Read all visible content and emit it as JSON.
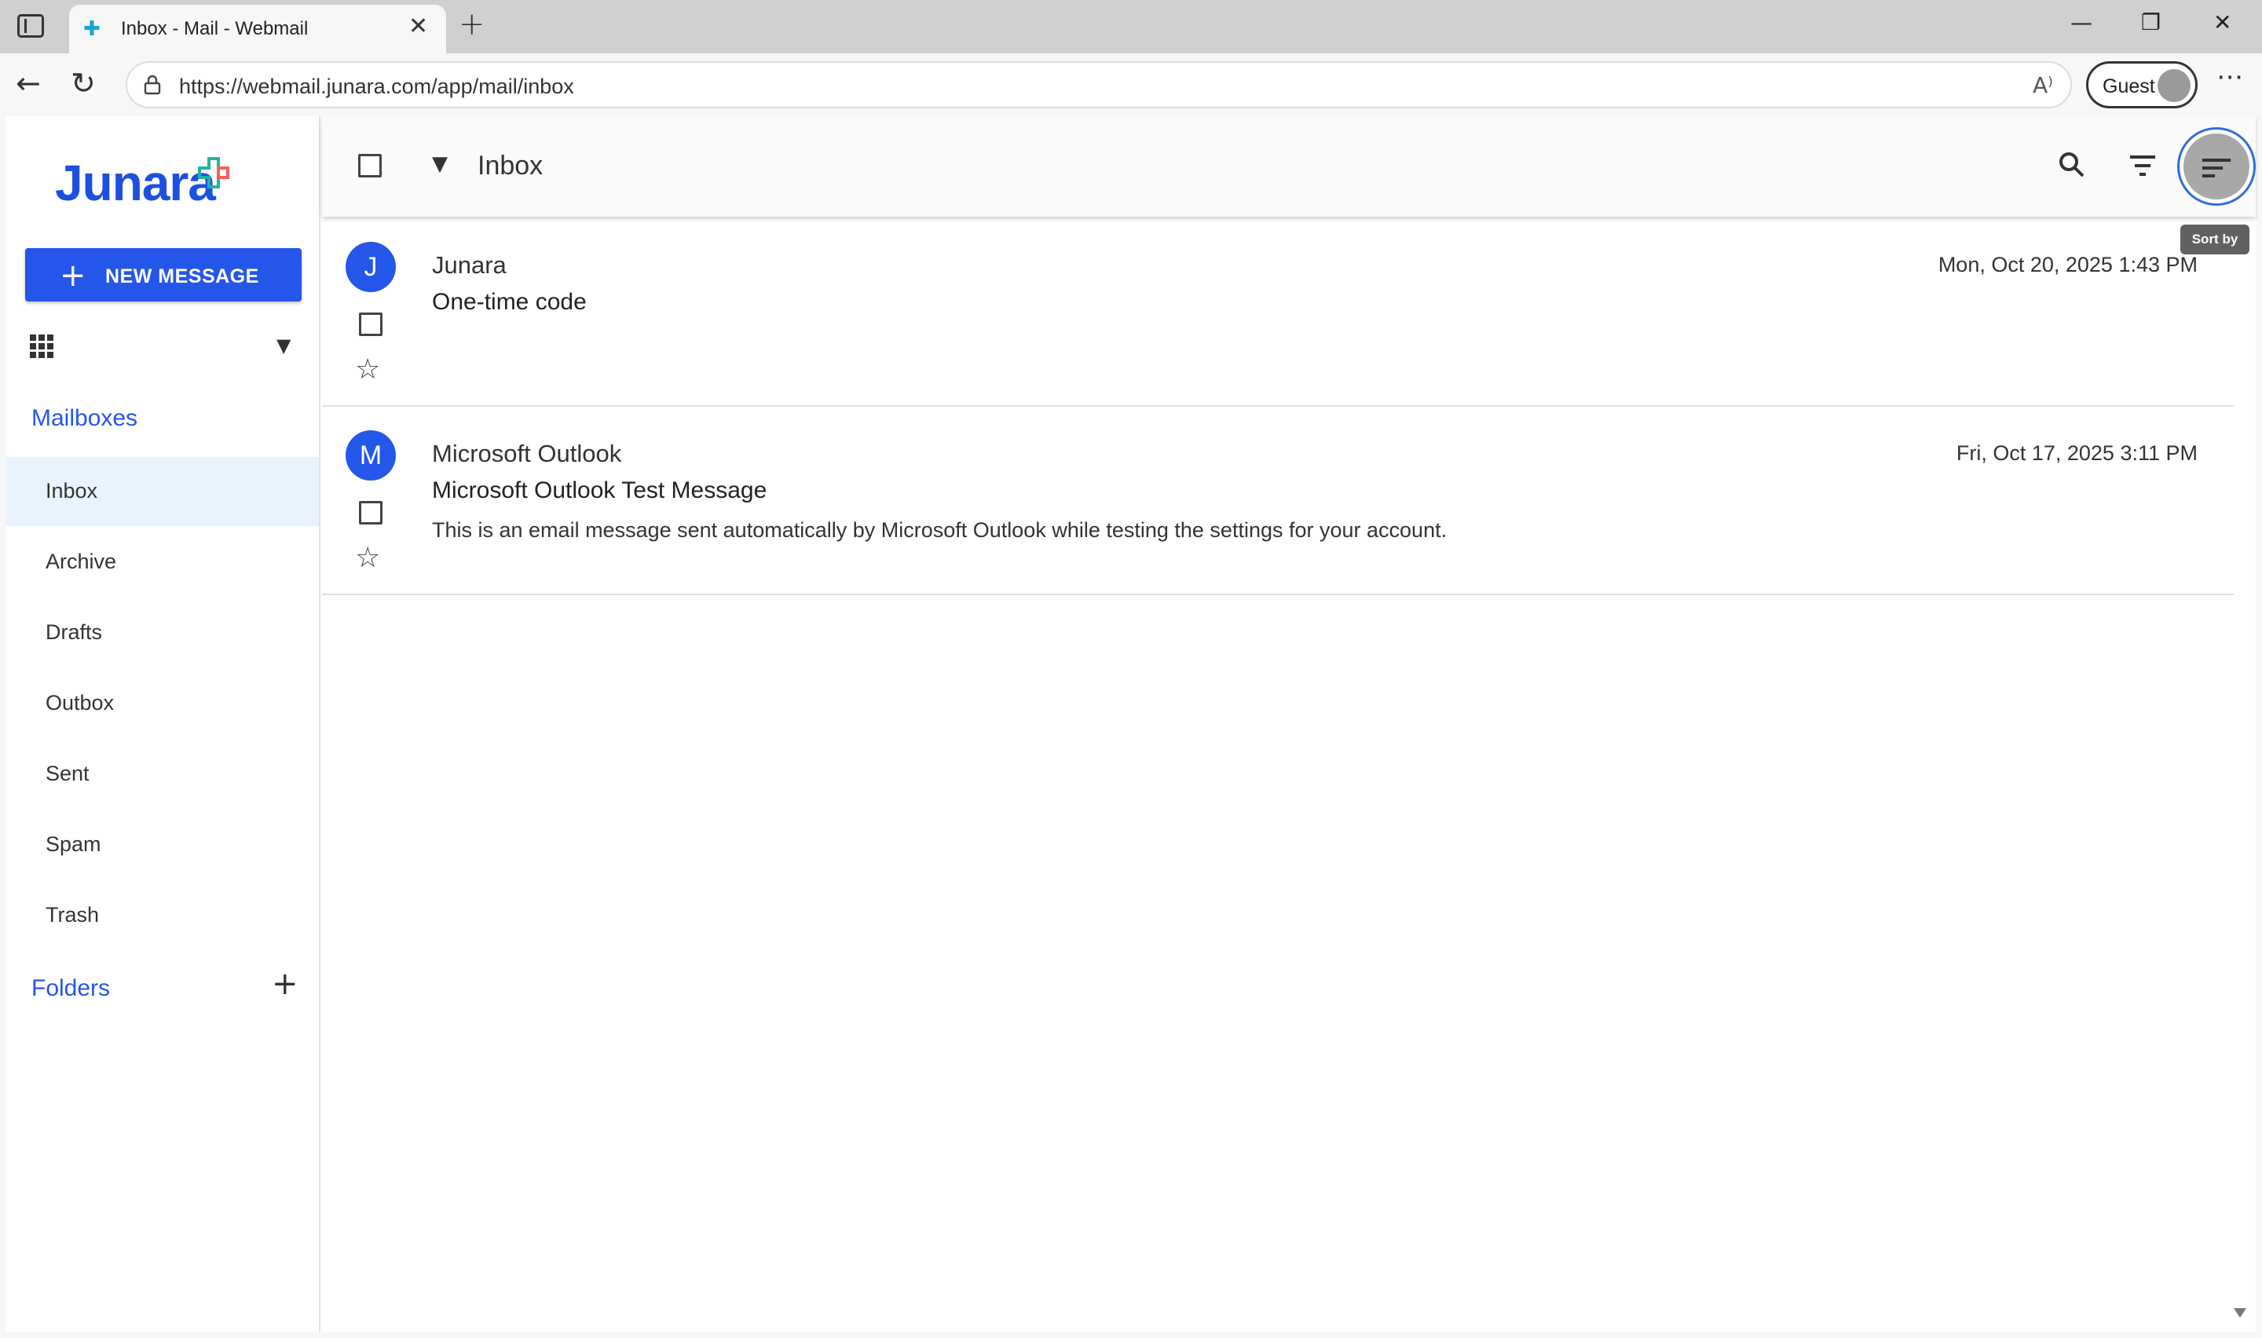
{
  "browser": {
    "tab_title": "Inbox - Mail - Webmail",
    "url": "https://webmail.junara.com/app/mail/inbox",
    "profile_label": "Guest",
    "icons": [
      "sidebar-toggle-icon",
      "close-icon",
      "plus-icon",
      "minimize-icon",
      "restore-icon",
      "close-window-icon",
      "back-arrow-icon",
      "reload-icon",
      "lock-icon",
      "read-aloud-icon",
      "avatar-icon",
      "more-icon"
    ]
  },
  "app": {
    "logo_text": "Junara",
    "new_message_label": "NEW MESSAGE",
    "mailboxes_title": "Mailboxes",
    "mailboxes": [
      {
        "label": "Inbox",
        "active": true
      },
      {
        "label": "Archive",
        "active": false
      },
      {
        "label": "Drafts",
        "active": false
      },
      {
        "label": "Outbox",
        "active": false
      },
      {
        "label": "Sent",
        "active": false
      },
      {
        "label": "Spam",
        "active": false
      },
      {
        "label": "Trash",
        "active": false
      }
    ],
    "folders_title": "Folders",
    "accent_color": "#2556ea"
  },
  "header": {
    "title": "Inbox",
    "tooltip": "Sort by"
  },
  "messages": [
    {
      "initial": "J",
      "from": "Junara",
      "subject": "One-time code",
      "preview": "",
      "date": "Mon, Oct 20, 2025 1:43 PM"
    },
    {
      "initial": "M",
      "from": "Microsoft Outlook",
      "subject": "Microsoft Outlook Test Message",
      "preview": "This is an email message sent automatically by Microsoft Outlook while testing the settings for your account.",
      "date": "Fri, Oct 17, 2025 3:11 PM"
    }
  ]
}
